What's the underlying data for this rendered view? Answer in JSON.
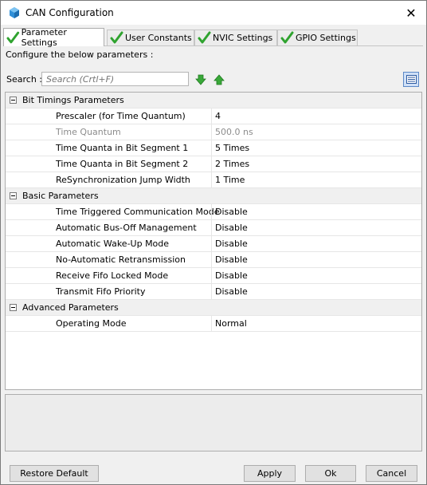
{
  "window": {
    "title": "CAN Configuration",
    "close_glyph": "✕"
  },
  "tabs": [
    {
      "label": "Parameter Settings",
      "active": true,
      "icon": "checkmark-icon"
    },
    {
      "label": "User Constants",
      "active": false,
      "icon": "checkmark-icon"
    },
    {
      "label": "NVIC Settings",
      "active": false,
      "icon": "checkmark-icon"
    },
    {
      "label": "GPIO Settings",
      "active": false,
      "icon": "checkmark-icon"
    }
  ],
  "configure_text": "Configure the below parameters :",
  "search": {
    "label": "Search :",
    "placeholder": "Search (Crtl+F)"
  },
  "colors": {
    "accent_check": "#2fa32f",
    "arrow_green": "#2fa32f",
    "category_bg": "#f0f0f0"
  },
  "groups": [
    {
      "name": "Bit Timings Parameters",
      "params": [
        {
          "name": "Prescaler (for Time Quantum)",
          "value": "4",
          "disabled": false
        },
        {
          "name": "Time Quantum",
          "value": "500.0 ns",
          "disabled": true
        },
        {
          "name": "Time Quanta in Bit Segment 1",
          "value": "5 Times",
          "disabled": false
        },
        {
          "name": "Time Quanta in Bit Segment 2",
          "value": "2 Times",
          "disabled": false
        },
        {
          "name": "ReSynchronization Jump Width",
          "value": "1 Time",
          "disabled": false
        }
      ]
    },
    {
      "name": "Basic Parameters",
      "params": [
        {
          "name": "Time Triggered Communication Mode",
          "value": "Disable",
          "disabled": false
        },
        {
          "name": "Automatic Bus-Off Management",
          "value": "Disable",
          "disabled": false
        },
        {
          "name": "Automatic Wake-Up Mode",
          "value": "Disable",
          "disabled": false
        },
        {
          "name": "No-Automatic Retransmission",
          "value": "Disable",
          "disabled": false
        },
        {
          "name": "Receive Fifo Locked Mode",
          "value": "Disable",
          "disabled": false
        },
        {
          "name": "Transmit Fifo Priority",
          "value": "Disable",
          "disabled": false
        }
      ]
    },
    {
      "name": "Advanced Parameters",
      "params": [
        {
          "name": "Operating Mode",
          "value": "Normal",
          "disabled": false
        }
      ]
    }
  ],
  "buttons": {
    "restore": "Restore Default",
    "apply": "Apply",
    "ok": "Ok",
    "cancel": "Cancel"
  }
}
